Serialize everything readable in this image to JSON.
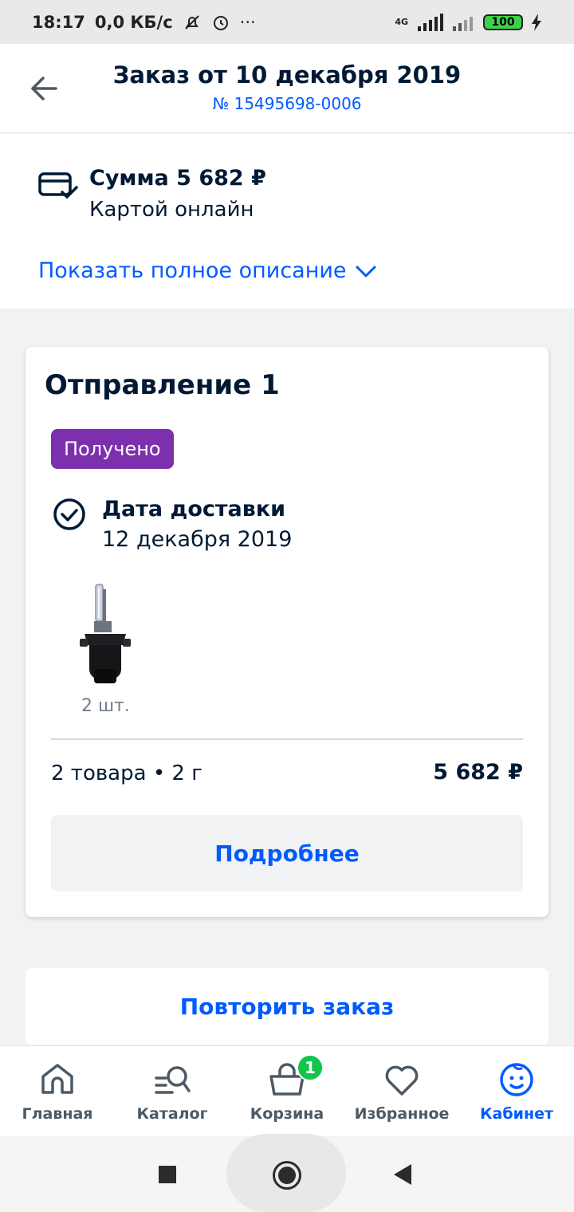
{
  "status_bar": {
    "time": "18:17",
    "speed": "0,0 КБ/с",
    "network": "4G",
    "battery": "100",
    "dots": "···"
  },
  "header": {
    "title": "Заказ от 10 декабря 2019",
    "order_number": "№ 15495698-0006"
  },
  "summary": {
    "sum_label": "Сумма 5 682 ₽",
    "payment_method": "Картой онлайн",
    "show_more": "Показать полное описание"
  },
  "shipment": {
    "title": "Отправление 1",
    "status": "Получено",
    "status_color": "#7d30ad",
    "delivery_label": "Дата доставки",
    "delivery_date": "12 декабря 2019",
    "product_icon": "xenon-bulb-image",
    "quantity": "2 шт.",
    "items_info": "2 товара • 2 г",
    "total": "5 682 ₽",
    "details_button": "Подробнее"
  },
  "repeat_button": "Повторить заказ",
  "bottom_nav": {
    "items": [
      {
        "label": "Главная",
        "icon": "home-icon"
      },
      {
        "label": "Каталог",
        "icon": "catalog-search-icon"
      },
      {
        "label": "Корзина",
        "icon": "basket-icon",
        "badge": "1"
      },
      {
        "label": "Избранное",
        "icon": "heart-icon"
      },
      {
        "label": "Кабинет",
        "icon": "smiley-face-icon",
        "active": true
      }
    ]
  },
  "colors": {
    "accent": "#005bff",
    "text": "#001a34",
    "badge_green": "#10c44c"
  }
}
